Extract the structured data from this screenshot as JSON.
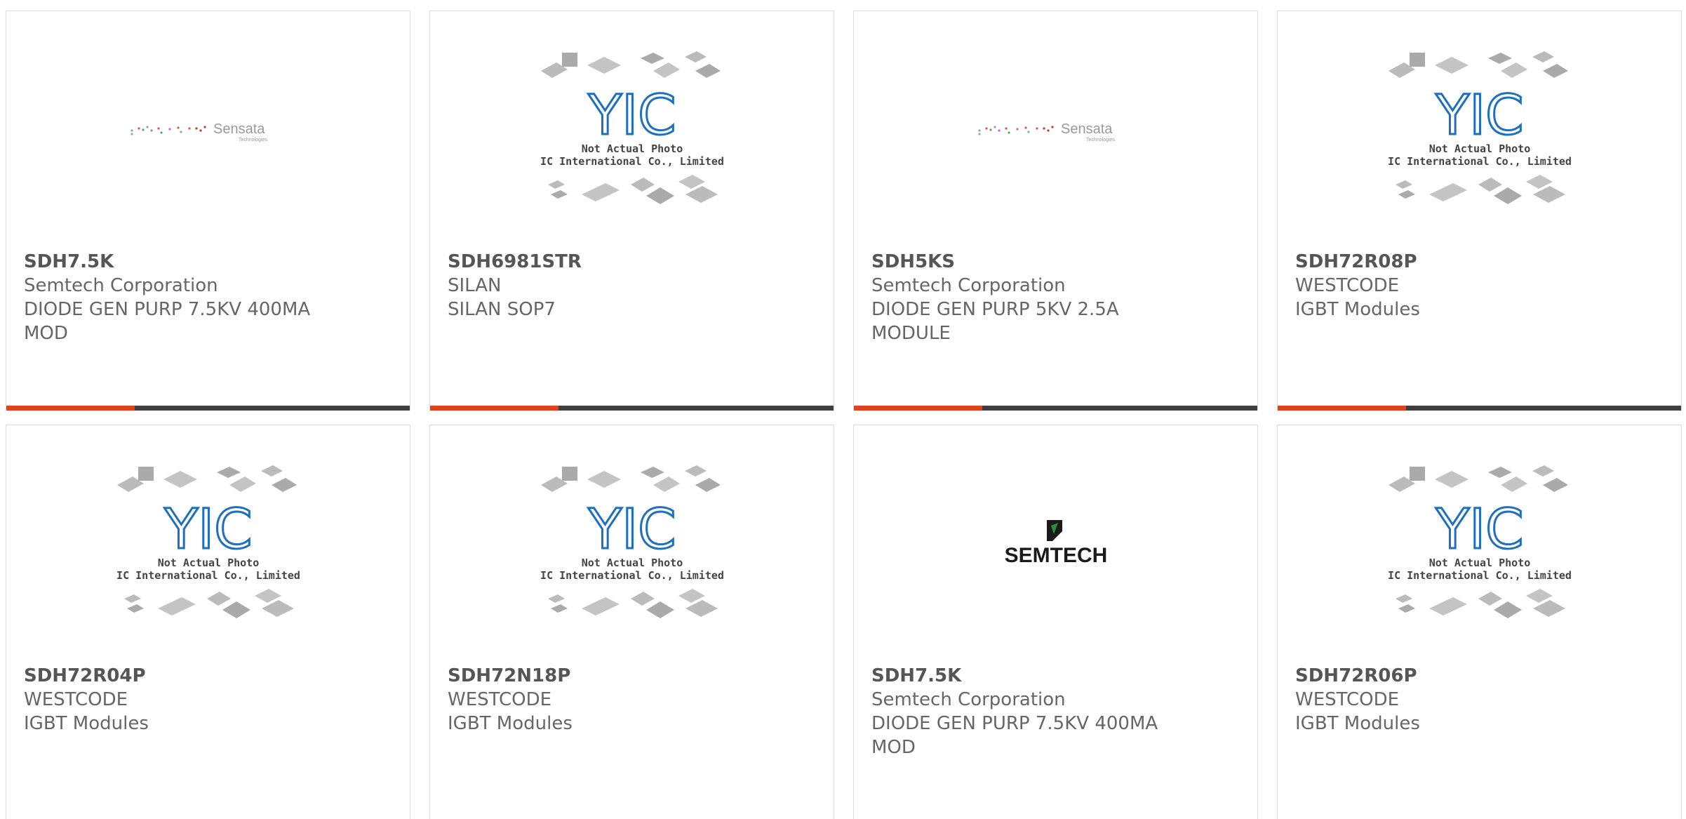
{
  "colors": {
    "accent": "#e2421b",
    "bar": "#3e3e3e",
    "border": "#dcdcdc",
    "yic_blue": "#1f6fc0"
  },
  "placeholder": {
    "line1": "Not Actual Photo",
    "line2": "YIC International Co., Limited.",
    "logo": "YIC"
  },
  "sensata": {
    "brand": "Sensata",
    "tagline": "Technologies"
  },
  "semtech": {
    "brand": "SEMTECH"
  },
  "cards": [
    {
      "pn": "SDH7.5K",
      "mfr": "Semtech Corporation",
      "desc": "DIODE GEN PURP 7.5KV 400MA MOD",
      "image": "sensata-logo"
    },
    {
      "pn": "SDH6981STR",
      "mfr": "SILAN",
      "desc": "SILAN SOP7",
      "image": "yic-placeholder"
    },
    {
      "pn": "SDH5KS",
      "mfr": "Semtech Corporation",
      "desc": "DIODE GEN PURP 5KV 2.5A MODULE",
      "image": "sensata-logo"
    },
    {
      "pn": "SDH72R08P",
      "mfr": "WESTCODE",
      "desc": "IGBT Modules",
      "image": "yic-placeholder"
    },
    {
      "pn": "SDH72R04P",
      "mfr": "WESTCODE",
      "desc": "IGBT Modules",
      "image": "yic-placeholder"
    },
    {
      "pn": "SDH72N18P",
      "mfr": "WESTCODE",
      "desc": "IGBT Modules",
      "image": "yic-placeholder"
    },
    {
      "pn": "SDH7.5K",
      "mfr": "Semtech Corporation",
      "desc": "DIODE GEN PURP 7.5KV 400MA MOD",
      "image": "semtech-logo"
    },
    {
      "pn": "SDH72R06P",
      "mfr": "WESTCODE",
      "desc": "IGBT Modules",
      "image": "yic-placeholder"
    }
  ]
}
